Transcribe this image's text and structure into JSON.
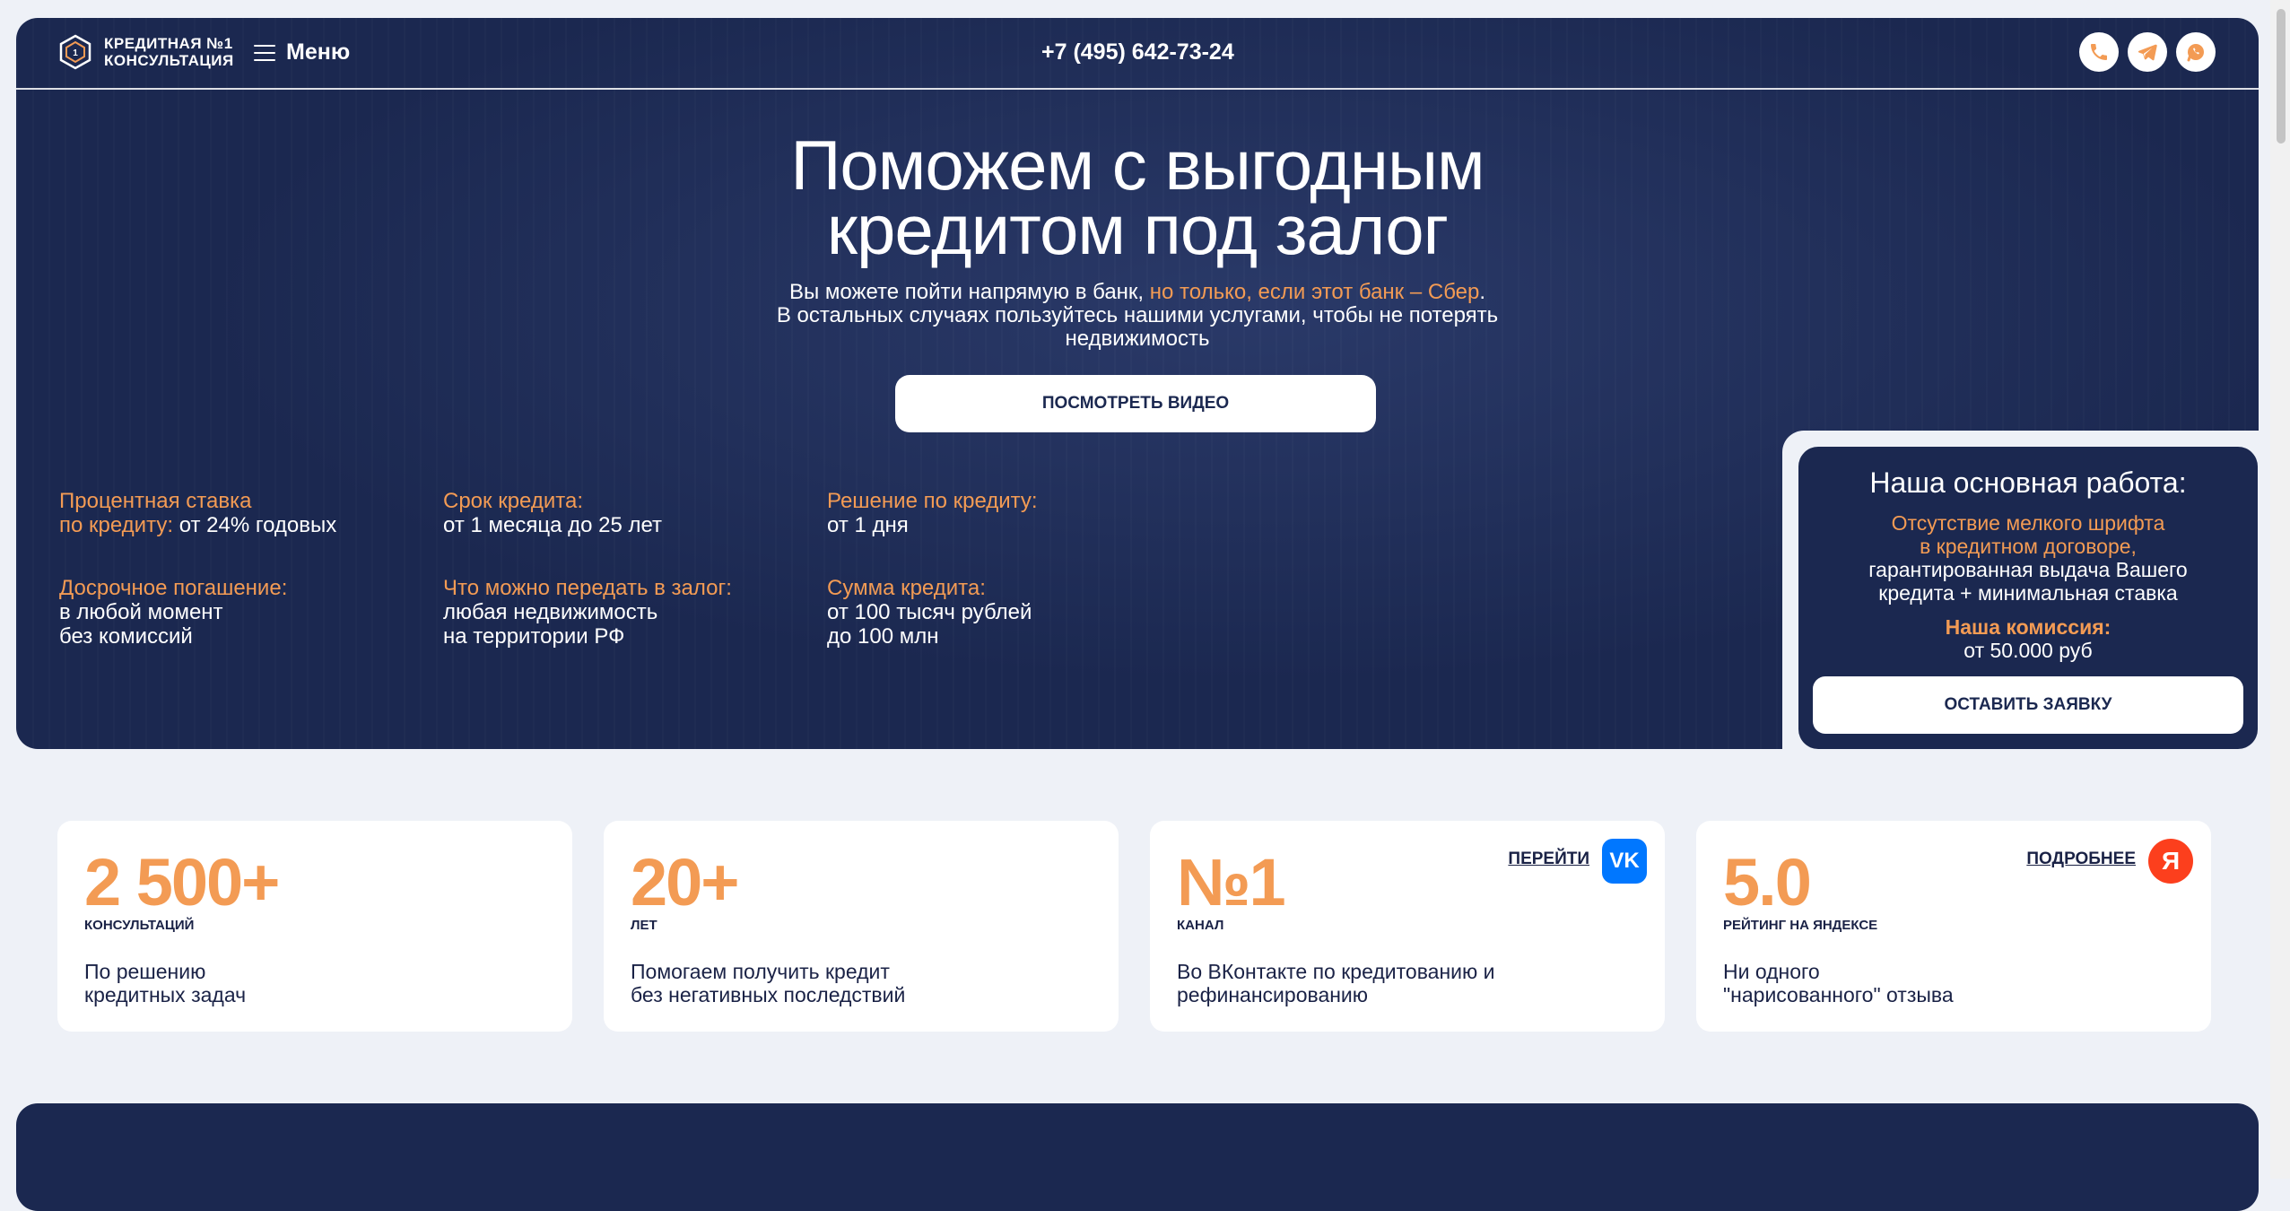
{
  "header": {
    "logo_line1": "КРЕДИТНАЯ №1",
    "logo_line2": "КОНСУЛЬТАЦИЯ",
    "menu_label": "Меню",
    "phone": "+7 (495) 642-73-24"
  },
  "hero": {
    "title_line1": "Поможем с выгодным",
    "title_line2": "кредитом под залог",
    "sub_part1": "Вы можете пойти напрямую в банк, ",
    "sub_highlight": "но только, если этот банк – Сбер",
    "sub_part2": ".",
    "sub_line2": "В остальных случаях пользуйтесь нашими услугами, чтобы не потерять",
    "sub_line3": "недвижимость",
    "video_button": "ПОСМОТРЕТЬ ВИДЕО"
  },
  "facts": [
    {
      "label": "Процентная ставка",
      "label2": "по кредиту:",
      "value": " от 24% годовых"
    },
    {
      "label": "Срок кредита:",
      "value": "от 1 месяца до 25 лет"
    },
    {
      "label": "Решение по кредиту:",
      "value": "от 1 дня"
    },
    {
      "label": "Досрочное погашение:",
      "value": "в любой момент",
      "value2": "без комиссий"
    },
    {
      "label": "Что можно передать в залог:",
      "value": "любая недвижимость",
      "value2": "на территории РФ"
    },
    {
      "label": "Сумма кредита:",
      "value": "от 100 тысяч рублей",
      "value2": "до 100 млн"
    }
  ],
  "work_card": {
    "title": "Наша основная работа:",
    "highlight1": "Отсутствие мелкого шрифта",
    "highlight2": "в кредитном договоре,",
    "text1": "гарантированная выдача Вашего",
    "text2": "кредита + минимальная ставка",
    "fee_label": "Наша комиссия:",
    "fee_value": "от 50.000 руб",
    "apply_button": "ОСТАВИТЬ ЗАЯВКУ"
  },
  "stats": [
    {
      "number": "2 500+",
      "unit": "КОНСУЛЬТАЦИЙ",
      "desc1": "По решению",
      "desc2": "кредитных задач"
    },
    {
      "number": "20+",
      "unit": "ЛЕТ",
      "desc1": "Помогаем получить кредит",
      "desc2": "без негативных последствий"
    },
    {
      "number": "№1",
      "unit": "КАНАЛ",
      "desc1": "Во ВКонтакте по кредитованию и",
      "desc2": "рефинансированию",
      "link": "ПЕРЕЙТИ",
      "badge": "vk-icon"
    },
    {
      "number": "5.0",
      "unit": "РЕЙТИНГ НА ЯНДЕКСЕ",
      "desc1": "Ни одного",
      "desc2": "\"нарисованного\" отзыва",
      "link": "ПОДРОБНЕЕ",
      "badge": "yandex-icon"
    }
  ],
  "colors": {
    "navy": "#1b2850",
    "accent": "#f39b54",
    "background": "#eef1f7"
  }
}
